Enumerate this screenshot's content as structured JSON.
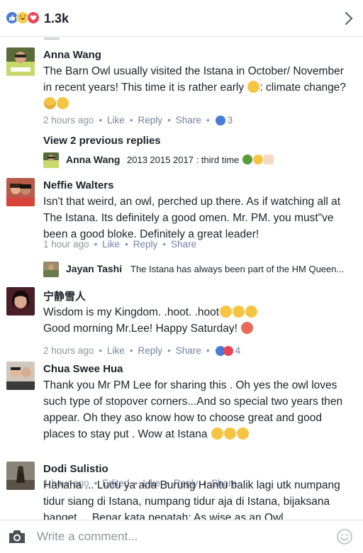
{
  "header": {
    "reaction_count": "1.3k",
    "reaction_icons": [
      "like-icon",
      "haha-icon",
      "love-icon"
    ]
  },
  "colors": {
    "link_blue": "#4a7bd6",
    "meta_gray": "#90949c",
    "meta_action": "#7383a4",
    "divider": "#dddfe2"
  },
  "comments": [
    {
      "name": "Anna Wang",
      "text": "The Barn Owl usually visited the Istana in October/ November in recent years! This time it is rather early",
      "text_tail": ": climate change?",
      "time": "2 hours ago",
      "like": "Like",
      "reply": "Reply",
      "share": "Share",
      "reaction_count": "3"
    },
    {
      "name": "Neffie Walters",
      "text": "Isn't that weird, an owl, perched up there. As if watching all at The Istana. Its definitely a good omen. Mr. PM. you must\"ve been a good bloke. Definitely a great leader!",
      "time": "1 hour ago",
      "like": "Like",
      "reply": "Reply",
      "share": "Share"
    },
    {
      "name": "宁静雪人",
      "line1": "Wisdom is my Kingdom. .hoot. .hoot",
      "line2": "Good morning Mr.Lee! Happy Saturday!",
      "time": "2 hours ago",
      "like": "Like",
      "reply": "Reply",
      "share": "Share",
      "reaction_count": "4"
    },
    {
      "name": "Chua Swee Hua",
      "text": "Thank you Mr PM Lee for sharing this . Oh yes the owl loves such type of stopover corners...And so special two years then appear.  Oh they aso know how to choose great and good places to stay put . Wow at Istana",
      "time": "1 hour ago",
      "edited": "Edited",
      "like": "Like",
      "reply": "Reply",
      "share": "Share"
    },
    {
      "name": "Dodi Sulistio",
      "text": "Hahaha ... Lucu ya ada Burung Hantu balik lagi utk numpang tidur siang di Istana, numpang tidur aja di Istana, bijaksana banget ... Benar kata pepatah:  As wise as an Owl."
    }
  ],
  "view_previous_replies": "View 2 previous replies",
  "replies": [
    {
      "name": "Anna Wang",
      "text": "2013 2015 2017 : third time"
    },
    {
      "name": "Jayan Tashi",
      "text": "The Istana has always been part of the HM Queen..."
    }
  ],
  "composer": {
    "placeholder": "Write a comment..."
  }
}
